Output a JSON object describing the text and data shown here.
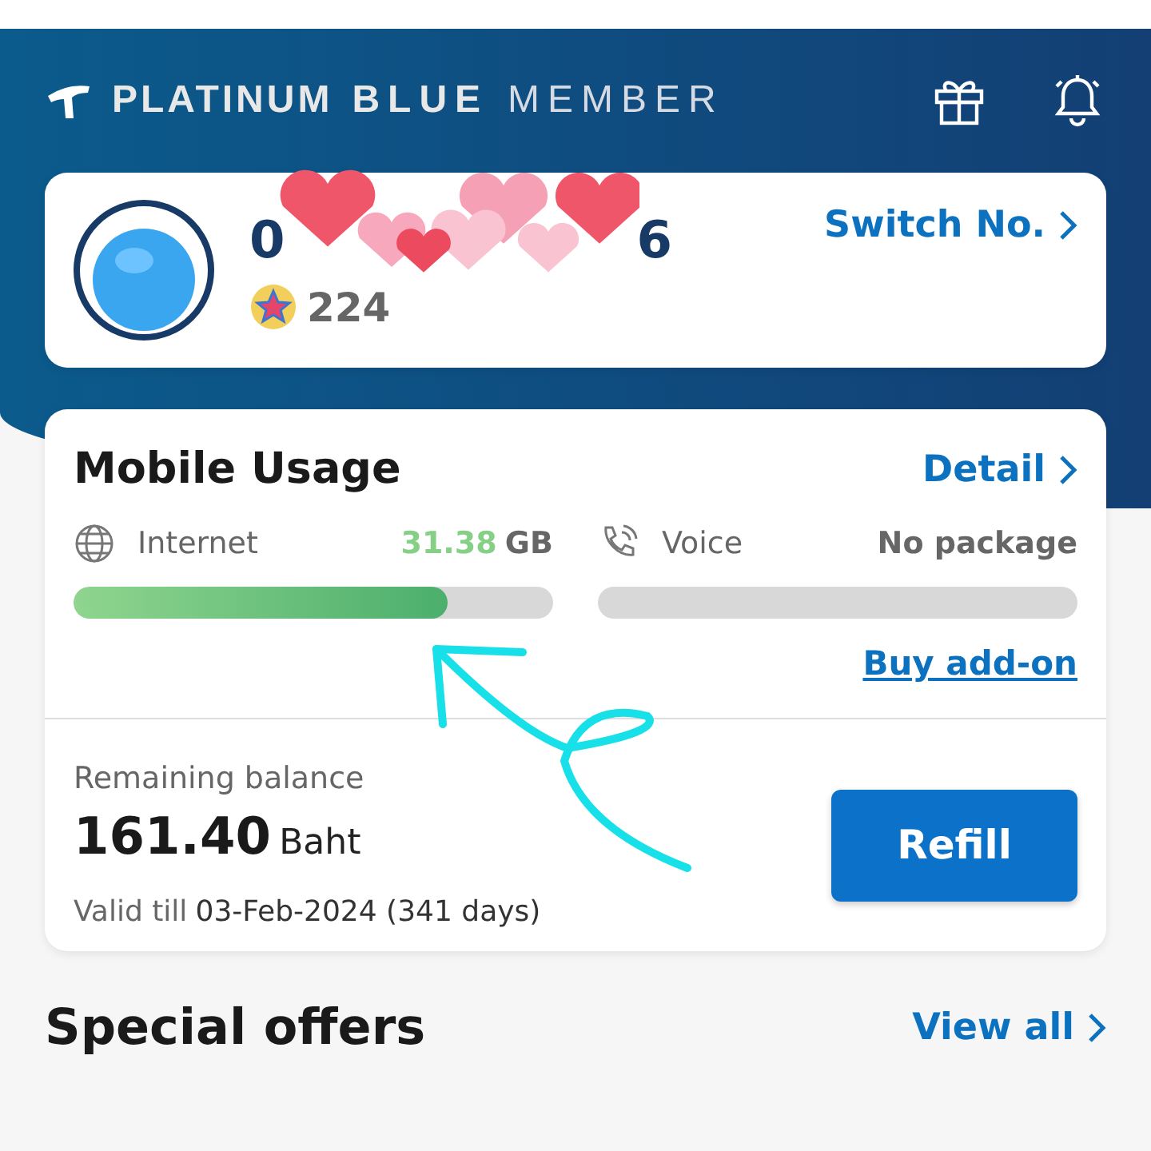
{
  "header": {
    "brand_bold": "PLATINUM",
    "brand_accent": "BLUE",
    "brand_light": "MEMBER"
  },
  "profile": {
    "phone_visible": [
      "0",
      "6"
    ],
    "points": "224",
    "switch_link": "Switch No."
  },
  "usage": {
    "title": "Mobile Usage",
    "detail_link": "Detail",
    "meters": [
      {
        "label": "Internet",
        "amount": "31.38",
        "unit": "GB",
        "level": 0.78
      },
      {
        "label": "Voice",
        "status": "No package"
      }
    ],
    "addon_link": "Buy add-on"
  },
  "balance": {
    "label": "Remaining balance",
    "amount": "161.40",
    "currency": "Baht",
    "valid_label": "Valid till",
    "valid_date": "03-Feb-2024 (341 days)",
    "button": "Refill"
  },
  "offers": {
    "title": "Special offers",
    "link": "View all"
  }
}
